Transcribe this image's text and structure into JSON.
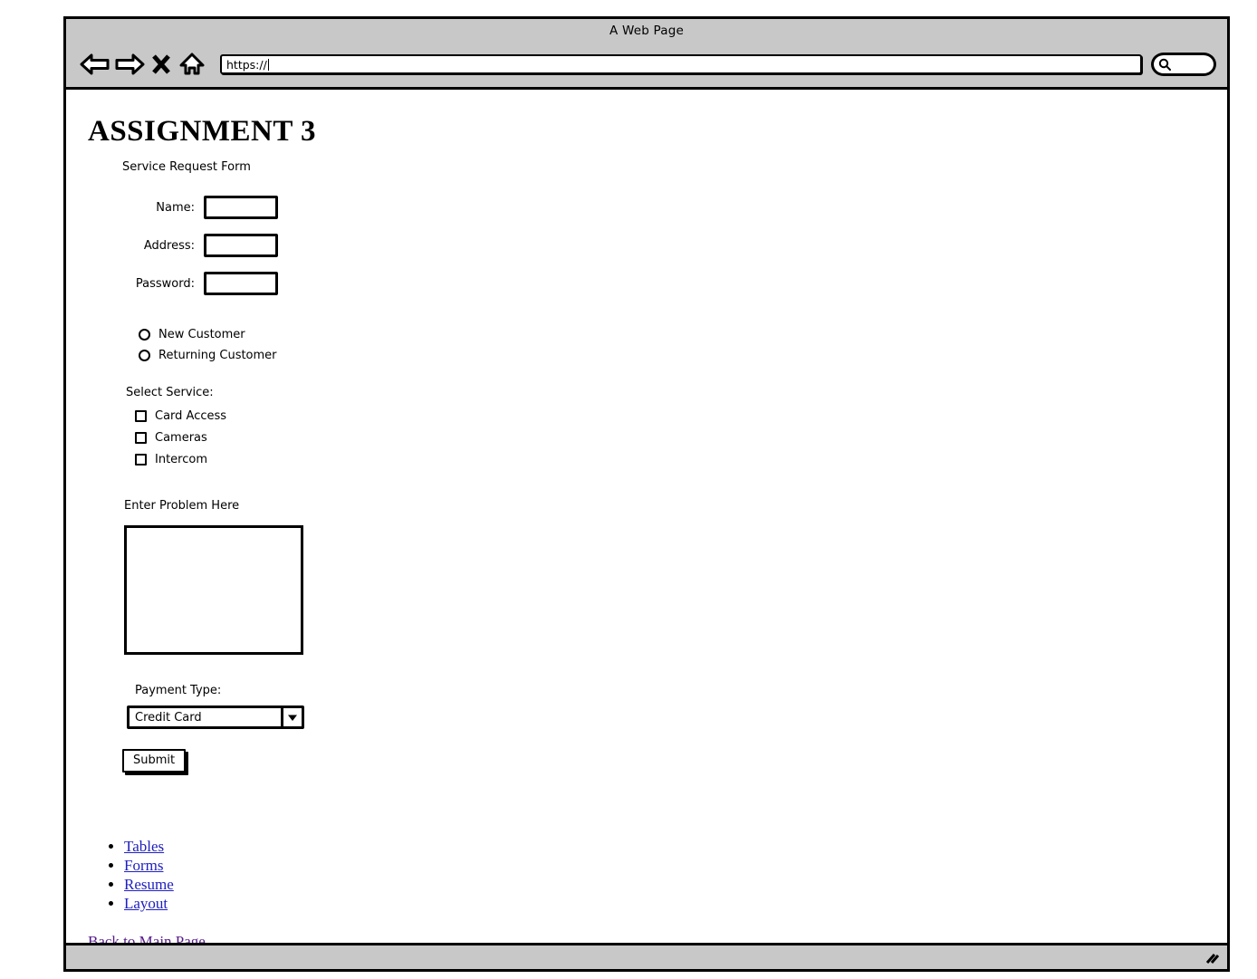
{
  "browser": {
    "window_title": "A Web Page",
    "url_value": "https://",
    "url_placeholder": "https://",
    "search_placeholder": "",
    "search_value": "",
    "icons": {
      "back": "back-arrow-icon",
      "forward": "forward-arrow-icon",
      "stop": "stop-x-icon",
      "home": "home-icon",
      "search": "search-icon",
      "resize": "resize-grip-icon"
    }
  },
  "page": {
    "title": "ASSIGNMENT 3",
    "form_subtitle": "Service Request Form",
    "fields": [
      {
        "label": "Name:",
        "value": "",
        "placeholder": ""
      },
      {
        "label": "Address:",
        "value": "",
        "placeholder": ""
      },
      {
        "label": "Password:",
        "value": "",
        "placeholder": ""
      }
    ],
    "customer_type": {
      "options": [
        {
          "label": "New Customer",
          "selected": false
        },
        {
          "label": "Returning Customer",
          "selected": false
        }
      ]
    },
    "services": {
      "heading": "Select Service:",
      "options": [
        {
          "label": "Card Access",
          "checked": false
        },
        {
          "label": "Cameras",
          "checked": false
        },
        {
          "label": "Intercom",
          "checked": false
        }
      ]
    },
    "problem": {
      "heading": "Enter Problem Here",
      "value": "",
      "placeholder": ""
    },
    "payment": {
      "heading": "Payment Type:",
      "selected": "Credit Card",
      "options": [
        "Credit Card"
      ]
    },
    "submit_label": "Submit",
    "links": [
      {
        "label": "Tables"
      },
      {
        "label": "Forms"
      },
      {
        "label": "Resume"
      },
      {
        "label": "Layout"
      }
    ],
    "back_link": "Back to Main Page"
  },
  "colors": {
    "chrome_gray": "#c8c8c8",
    "link_blue": "#2020c0",
    "link_visited": "#551a8b",
    "outline_black": "#000000",
    "page_white": "#ffffff"
  }
}
